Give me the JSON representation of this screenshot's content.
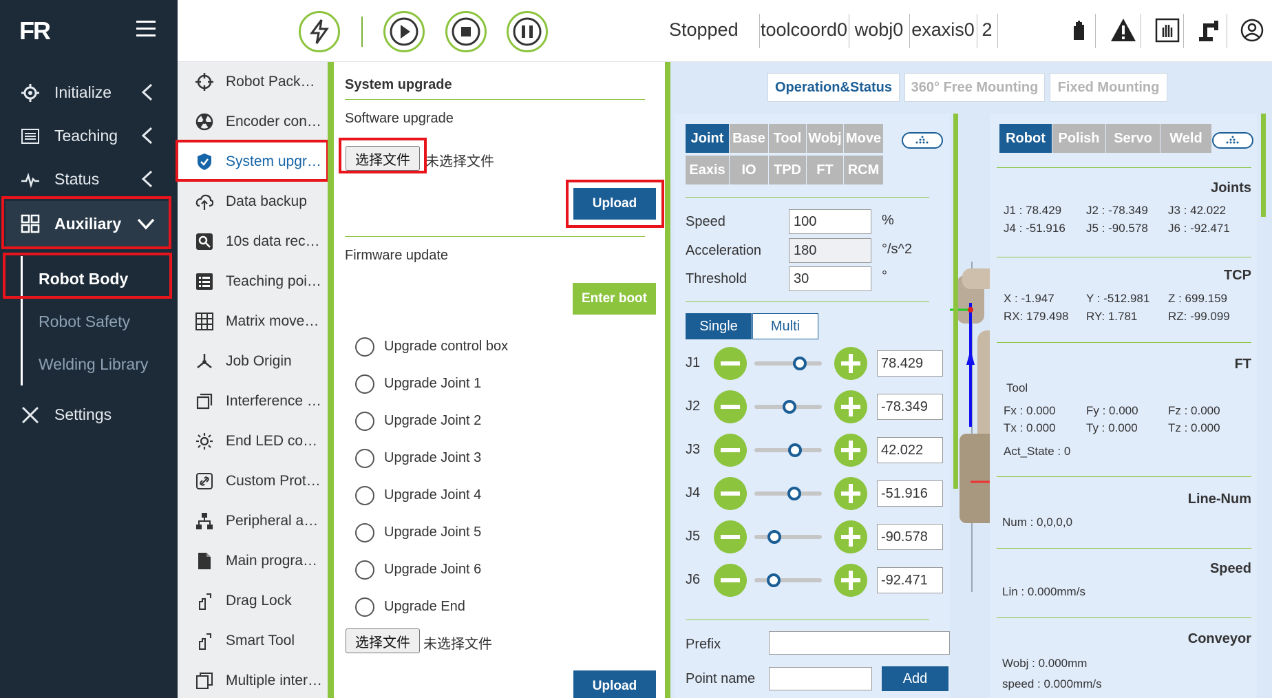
{
  "brand": {
    "logo": "FR"
  },
  "sidebar": {
    "items": [
      {
        "label": "Initialize",
        "icon": "gear-icon"
      },
      {
        "label": "Teaching",
        "icon": "list-icon"
      },
      {
        "label": "Status",
        "icon": "pulse-icon"
      },
      {
        "label": "Auxiliary",
        "icon": "grid-icon"
      },
      {
        "label": "Settings",
        "icon": "tools-icon"
      }
    ],
    "subitems": [
      "Robot Body",
      "Robot Safety",
      "Welding Library"
    ]
  },
  "topbar": {
    "status": "Stopped",
    "tool": "toolcoord0",
    "wobj": "wobj0",
    "exaxis": "exaxis0",
    "count": "2"
  },
  "menu2": {
    "items": [
      "Robot Pack…",
      "Encoder con…",
      "System upgr…",
      "Data backup",
      "10s data rec…",
      "Teaching poi…",
      "Matrix move…",
      "Job Origin",
      "Interference …",
      "End LED co…",
      "Custom Prot…",
      "Peripheral a…",
      "Main progra…",
      "Drag Lock",
      "Smart Tool",
      "Multiple inter…"
    ]
  },
  "upgrade": {
    "title": "System upgrade",
    "software_label": "Software upgrade",
    "choose_file": "选择文件",
    "no_file": "未选择文件",
    "upload": "Upload",
    "firmware_label": "Firmware update",
    "enter_boot": "Enter boot",
    "options": [
      "Upgrade control box",
      "Upgrade Joint 1",
      "Upgrade Joint 2",
      "Upgrade Joint 3",
      "Upgrade Joint 4",
      "Upgrade Joint 5",
      "Upgrade Joint 6",
      "Upgrade End"
    ],
    "choose_file2": "选择文件",
    "no_file2": "未选择文件",
    "upload2": "Upload"
  },
  "view_tabs": [
    "Operation&Status",
    "360° Free Mounting",
    "Fixed Mounting"
  ],
  "control": {
    "modes_row1": [
      "Joint",
      "Base",
      "Tool",
      "Wobj",
      "Move"
    ],
    "modes_row2": [
      "Eaxis",
      "IO",
      "TPD",
      "FT",
      "RCM"
    ],
    "speed_label": "Speed",
    "speed": "100",
    "speed_unit": "%",
    "acc_label": "Acceleration",
    "acc": "180",
    "acc_unit": "°/s^2",
    "thr_label": "Threshold",
    "thr": "30",
    "thr_unit": "°",
    "single": "Single",
    "multi": "Multi",
    "joints": [
      {
        "name": "J1",
        "value": "78.429",
        "level": 0.67
      },
      {
        "name": "J2",
        "value": "-78.349",
        "level": 0.52
      },
      {
        "name": "J3",
        "value": "42.022",
        "level": 0.6
      },
      {
        "name": "J4",
        "value": "-51.916",
        "level": 0.59
      },
      {
        "name": "J5",
        "value": "-90.578",
        "level": 0.3
      },
      {
        "name": "J6",
        "value": "-92.471",
        "level": 0.29
      }
    ],
    "prefix_label": "Prefix",
    "point_label": "Point name",
    "add": "Add"
  },
  "status_panel": {
    "tabs": [
      "Robot",
      "Polish",
      "Servo",
      "Weld"
    ],
    "joints_h": "Joints",
    "joints": [
      "J1 : 78.429",
      "J2 : -78.349",
      "J3 : 42.022",
      "J4 : -51.916",
      "J5 : -90.578",
      "J6 : -92.471"
    ],
    "tcp_h": "TCP",
    "tcp": [
      "X   : -1.947",
      "Y   : -512.981",
      "Z   : 699.159",
      "RX: 179.498",
      "RY: 1.781",
      "RZ: -99.099"
    ],
    "ft_h": "FT",
    "ft_tool": "Tool",
    "ft": [
      "Fx : 0.000",
      "Fy : 0.000",
      "Fz : 0.000",
      "Tx : 0.000",
      "Ty : 0.000",
      "Tz : 0.000"
    ],
    "act_state": "Act_State  :      0",
    "line_h": "Line-Num",
    "num": "Num        :   0,0,0,0",
    "speed_h": "Speed",
    "lin": "Lin         :  0.000mm/s",
    "conv_h": "Conveyor",
    "wobj": "Wobj      :      0.000mm",
    "cspeed": "speed  :      0.000mm/s"
  }
}
